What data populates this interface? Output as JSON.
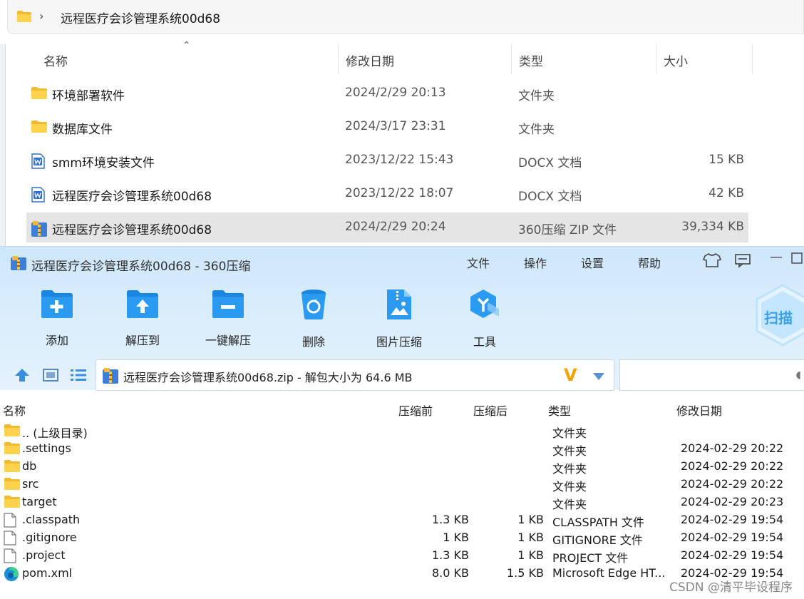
{
  "explorer": {
    "breadcrumb": "远程医疗会诊管理系统00d68",
    "columns": {
      "name": "名称",
      "date": "修改日期",
      "type": "类型",
      "size": "大小"
    },
    "rows": [
      {
        "icon": "folder-icon",
        "name": "环境部署软件",
        "date": "2024/2/29 20:13",
        "type": "文件夹",
        "size": ""
      },
      {
        "icon": "folder-icon",
        "name": "数据库文件",
        "date": "2024/3/17 23:31",
        "type": "文件夹",
        "size": ""
      },
      {
        "icon": "docx-icon",
        "name": "smm环境安装文件",
        "date": "2023/12/22 15:43",
        "type": "DOCX 文档",
        "size": "15 KB"
      },
      {
        "icon": "docx-icon",
        "name": "远程医疗会诊管理系统00d68",
        "date": "2023/12/22 18:07",
        "type": "DOCX 文档",
        "size": "42 KB"
      },
      {
        "icon": "zip-icon",
        "name": "远程医疗会诊管理系统00d68",
        "date": "2024/2/29 20:24",
        "type": "360压缩 ZIP 文件",
        "size": "39,334 KB",
        "selected": true
      }
    ]
  },
  "zip": {
    "title": "远程医疗会诊管理系统00d68 - 360压缩",
    "menu": [
      "文件",
      "操作",
      "设置",
      "帮助"
    ],
    "tools": [
      {
        "icon": "add-icon",
        "label": "添加"
      },
      {
        "icon": "extract-to-icon",
        "label": "解压到"
      },
      {
        "icon": "one-click-extract-icon",
        "label": "一键解压"
      },
      {
        "icon": "delete-icon",
        "label": "删除"
      },
      {
        "icon": "image-compress-icon",
        "label": "图片压缩"
      },
      {
        "icon": "tools-icon",
        "label": "工具"
      }
    ],
    "scan_label": "扫描",
    "path_text": "远程医疗会诊管理系统00d68.zip - 解包大小为 64.6 MB",
    "columns": {
      "name": "名称",
      "before": "压缩前",
      "after": "压缩后",
      "type": "类型",
      "date": "修改日期"
    },
    "rows": [
      {
        "icon": "folder-icon",
        "name": ".. (上级目录)",
        "before": "",
        "after": "",
        "type": "文件夹",
        "date": ""
      },
      {
        "icon": "folder-icon",
        "name": ".settings",
        "before": "",
        "after": "",
        "type": "文件夹",
        "date": "2024-02-29 20:22"
      },
      {
        "icon": "folder-icon",
        "name": "db",
        "before": "",
        "after": "",
        "type": "文件夹",
        "date": "2024-02-29 20:22"
      },
      {
        "icon": "folder-icon",
        "name": "src",
        "before": "",
        "after": "",
        "type": "文件夹",
        "date": "2024-02-29 20:22"
      },
      {
        "icon": "folder-icon",
        "name": "target",
        "before": "",
        "after": "",
        "type": "文件夹",
        "date": "2024-02-29 20:23"
      },
      {
        "icon": "file-icon",
        "name": ".classpath",
        "before": "1.3 KB",
        "after": "1 KB",
        "type": "CLASSPATH 文件",
        "date": "2024-02-29 19:54"
      },
      {
        "icon": "file-icon",
        "name": ".gitignore",
        "before": "1 KB",
        "after": "1 KB",
        "type": "GITIGNORE 文件",
        "date": "2024-02-29 19:54"
      },
      {
        "icon": "file-icon",
        "name": ".project",
        "before": "1.3 KB",
        "after": "1 KB",
        "type": "PROJECT 文件",
        "date": "2024-02-29 19:54"
      },
      {
        "icon": "edge-icon",
        "name": "pom.xml",
        "before": "8.0 KB",
        "after": "1.5 KB",
        "type": "Microsoft Edge HT...",
        "date": "2024-02-29 19:54"
      }
    ]
  },
  "watermark": "CSDN @清平毕设程序"
}
